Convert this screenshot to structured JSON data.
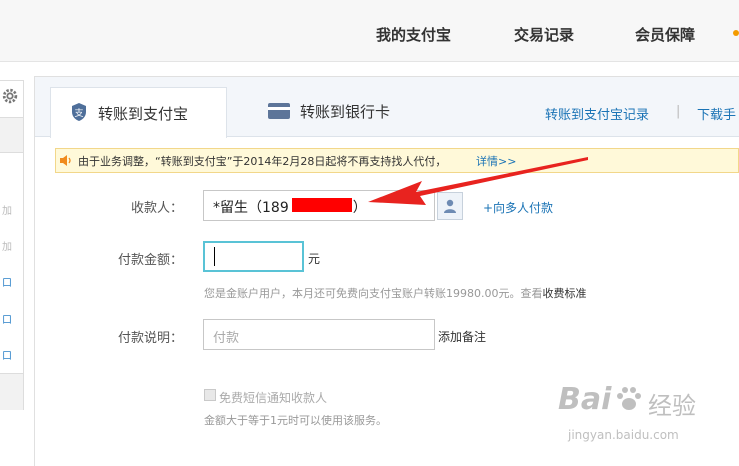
{
  "topnav": {
    "items": [
      "我的支付宝",
      "交易记录",
      "会员保障"
    ]
  },
  "left_panel": {
    "fragments": [
      "加",
      "加",
      "口",
      "口",
      "口"
    ]
  },
  "tabs": {
    "active_label": "转账到支付宝",
    "bank_label": "转账到银行卡"
  },
  "top_links": {
    "records": "转账到支付宝记录",
    "separator": "|",
    "download": "下载手"
  },
  "notice": {
    "text": "由于业务调整，“转账到支付宝”于2014年2月28日起将不再支持找人代付，",
    "link": "详情>>"
  },
  "form": {
    "recipient_label": "收款人：",
    "recipient_value_prefix": "*留生（189",
    "recipient_value_suffix": "）",
    "multi_link": "+向多人付款",
    "amount_label": "付款金额：",
    "amount_value": "",
    "amount_unit": "元",
    "amount_hint": "您是金账户用户，本月还可免费向支付宝账户转账19980.00元。查看",
    "amount_hint_link": "收费标准",
    "memo_label": "付款说明：",
    "memo_placeholder": "付款",
    "add_note": "添加备注",
    "sms_label": "免费短信通知收款人",
    "sms_hint": "金额大于等于1元时可以使用该服务。"
  },
  "watermark": {
    "brand": "Bai",
    "brand_tail": "经验",
    "url": "jingyan.baidu.com"
  },
  "colors": {
    "link": "#1a73b5",
    "accent_orange": "#f39b00",
    "arrow_red": "#e8231f",
    "notice_bg": "#fff9d9",
    "focus_border": "#59c3d6"
  },
  "icons": {
    "gear": "gear-icon",
    "shield": "shield-icon",
    "card": "bank-card-icon",
    "speaker": "speaker-icon",
    "contact": "contact-book-icon",
    "paw": "paw-icon"
  }
}
